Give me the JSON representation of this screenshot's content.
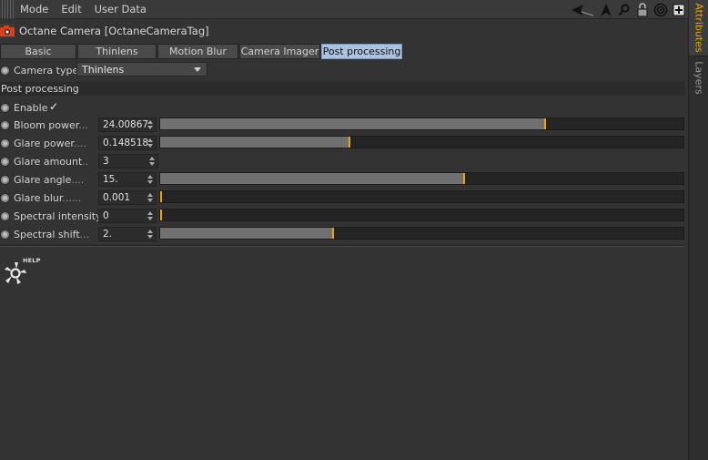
{
  "menu": {
    "items": [
      "Mode",
      "Edit",
      "User Data"
    ]
  },
  "header": {
    "title": "Octane Camera [OctaneCameraTag]"
  },
  "tabs": [
    {
      "label": "Basic",
      "active": false
    },
    {
      "label": "Thinlens",
      "active": false
    },
    {
      "label": "Motion Blur",
      "active": false
    },
    {
      "label": "Camera Imager",
      "active": false
    },
    {
      "label": "Post processing",
      "active": true
    }
  ],
  "camera_type": {
    "label": "Camera type",
    "value": "Thinlens"
  },
  "section": {
    "title": "Post processing"
  },
  "enable": {
    "label": "Enable",
    "checked": true,
    "check_glyph": "✓"
  },
  "params": [
    {
      "label": "Bloom power",
      "dots": "...",
      "value": "24.00867",
      "fraction": 0.735,
      "has_slider": true
    },
    {
      "label": "Glare power",
      "dots": "....",
      "value": "0.148518",
      "fraction": 0.362,
      "has_slider": true
    },
    {
      "label": "Glare amount",
      "dots": "..",
      "value": "3",
      "fraction": null,
      "has_slider": false
    },
    {
      "label": "Glare angle",
      "dots": "....",
      "value": "15.",
      "fraction": 0.58,
      "has_slider": true
    },
    {
      "label": "Glare blur",
      "dots": "......",
      "value": "0.001",
      "fraction": 0.0,
      "has_slider": true
    },
    {
      "label": "Spectral intensity",
      "dots": "",
      "value": "0",
      "fraction": 0.0,
      "has_slider": true
    },
    {
      "label": "Spectral shift",
      "dots": "...",
      "value": "2.",
      "fraction": 0.33,
      "has_slider": true
    }
  ],
  "help": {
    "label": "HELP"
  },
  "sidebar": {
    "tabs": [
      {
        "label": "Attributes",
        "active": true
      },
      {
        "label": "Layers",
        "active": false
      }
    ]
  },
  "colors": {
    "accent": "#f0a400",
    "active_tab": "#a9c3e0",
    "background": "#333333"
  },
  "icons": [
    "arrow-back-icon",
    "cursor-icon",
    "search-icon",
    "lock-icon",
    "target-icon",
    "new-window-icon",
    "camera-icon",
    "octane-help-icon"
  ]
}
